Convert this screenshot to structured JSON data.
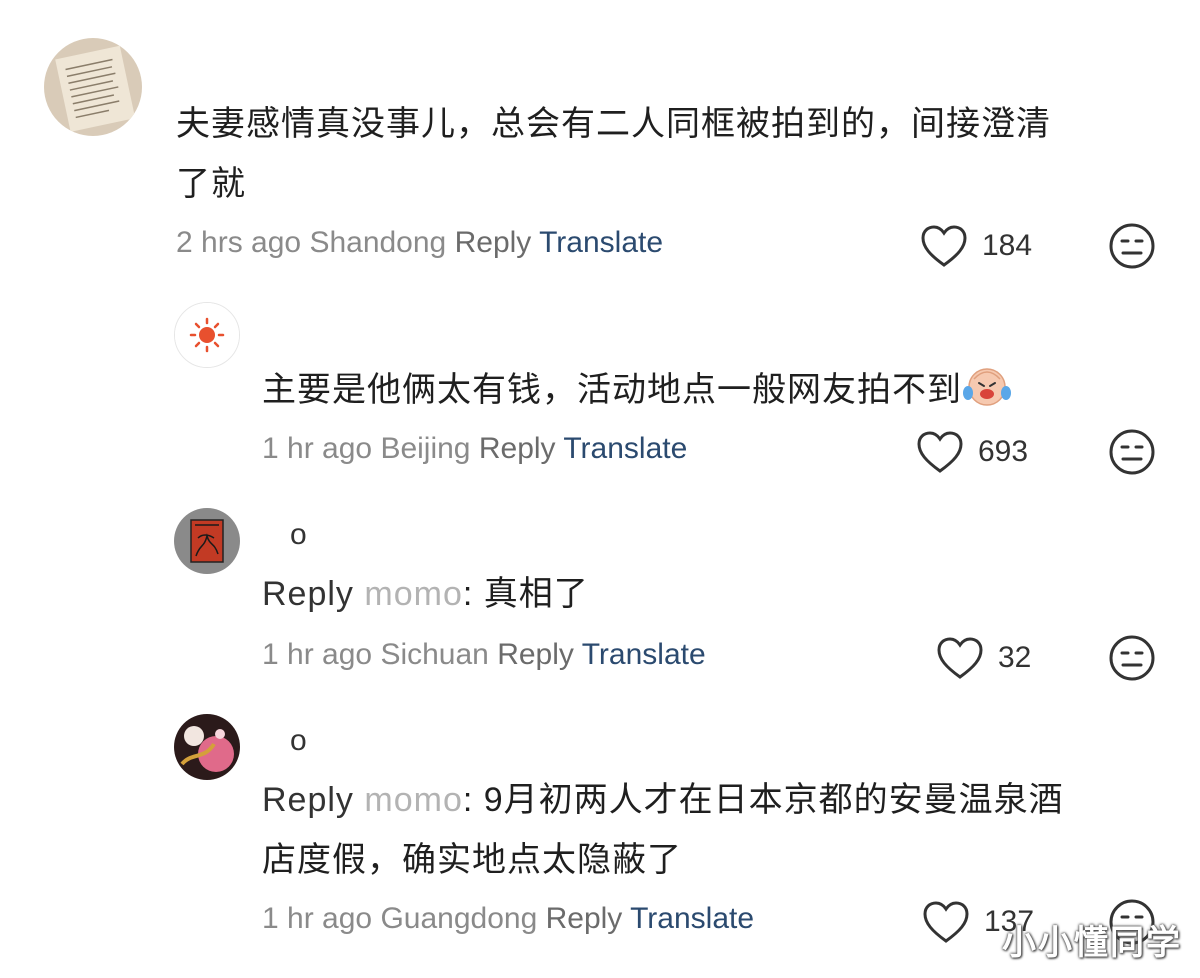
{
  "comments": [
    {
      "text_line1": "夫妻感情真没事儿，总会有二人同框被拍到的，间接澄清",
      "text_line2": "了就",
      "time": "2 hrs ago",
      "location": "Shandong",
      "reply_label": "Reply",
      "translate_label": "Translate",
      "likes": "184"
    },
    {
      "text_line1": "主要是他俩太有钱，活动地点一般网友拍不到",
      "time": "1 hr ago",
      "location": "Beijing",
      "reply_label": "Reply",
      "translate_label": "Translate",
      "likes": "693"
    },
    {
      "username": "o",
      "reply_prefix": "Reply",
      "reply_to": "momo",
      "text_line1": ": 真相了",
      "time": "1 hr ago",
      "location": "Sichuan",
      "reply_label": "Reply",
      "translate_label": "Translate",
      "likes": "32"
    },
    {
      "username": "o",
      "reply_prefix": "Reply",
      "reply_to": "momo",
      "text_line1": ": 9月初两人才在日本京都的安曼温泉酒",
      "text_line2": "店度假，确实地点太隐蔽了",
      "time": "1 hr ago",
      "location": "Guangdong",
      "reply_label": "Reply",
      "translate_label": "Translate",
      "likes": "137"
    }
  ],
  "icons": {
    "like": "heart-outline-icon",
    "dislike": "neutral-face-icon"
  },
  "colors": {
    "translate": "#2b4a6f",
    "meta": "#8a8a8a",
    "reply_to_name": "#b3b3b3"
  },
  "watermark": "小小懂同学"
}
